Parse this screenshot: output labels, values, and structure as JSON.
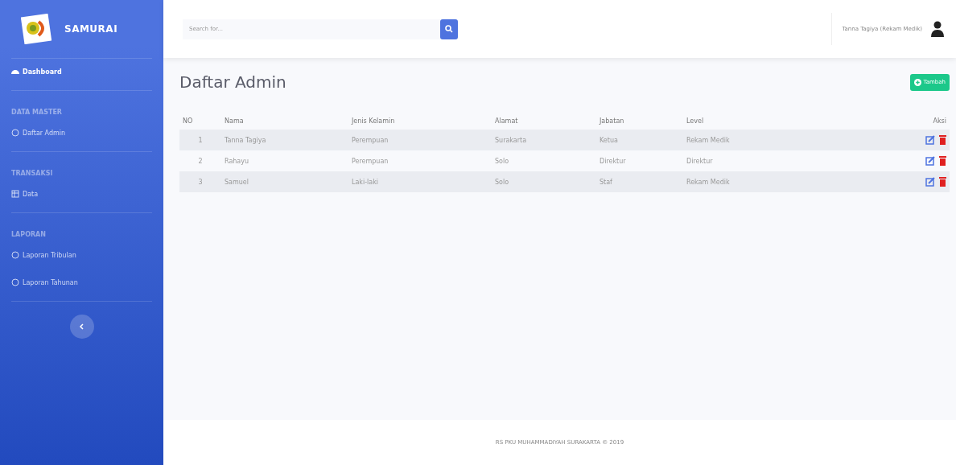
{
  "sidebar": {
    "brand": "SAMURAI",
    "items": [
      {
        "kind": "link",
        "label": "Dashboard",
        "selected": true
      },
      {
        "kind": "heading",
        "label": "DATA MASTER"
      },
      {
        "kind": "link",
        "label": "Daftar Admin",
        "selected": false
      },
      {
        "kind": "heading",
        "label": "TRANSAKSI"
      },
      {
        "kind": "link",
        "label": "Data",
        "selected": false
      },
      {
        "kind": "heading",
        "label": "LAPORAN"
      },
      {
        "kind": "link",
        "label": "Laporan Tribulan",
        "selected": false
      },
      {
        "kind": "link",
        "label": "Laporan Tahunan",
        "selected": false
      }
    ]
  },
  "topbar": {
    "search": {
      "placeholder": "Search for..."
    },
    "user": "Tanna Tagiya (Rekam Medik)"
  },
  "page": {
    "title": "Daftar Admin",
    "add_button": "Tambah"
  },
  "table": {
    "columns": [
      "NO",
      "Nama",
      "Jenis Kelamin",
      "Alamat",
      "Jabatan",
      "Level",
      "Aksi"
    ],
    "rows": [
      {
        "cells": [
          "1",
          "Tanna Tagiya",
          "Perempuan",
          "Surakarta",
          "Ketua",
          "Rekam Medik"
        ]
      },
      {
        "cells": [
          "2",
          "Rahayu",
          "Perempuan",
          "Solo",
          "Direktur",
          "Direktur"
        ]
      },
      {
        "cells": [
          "3",
          "Samuel",
          "Laki-laki",
          "Solo",
          "Staf",
          "Rekam Medik"
        ]
      }
    ]
  },
  "footer": "RS PKU MUHAMMADIYAH SURAKARTA © 2019"
}
